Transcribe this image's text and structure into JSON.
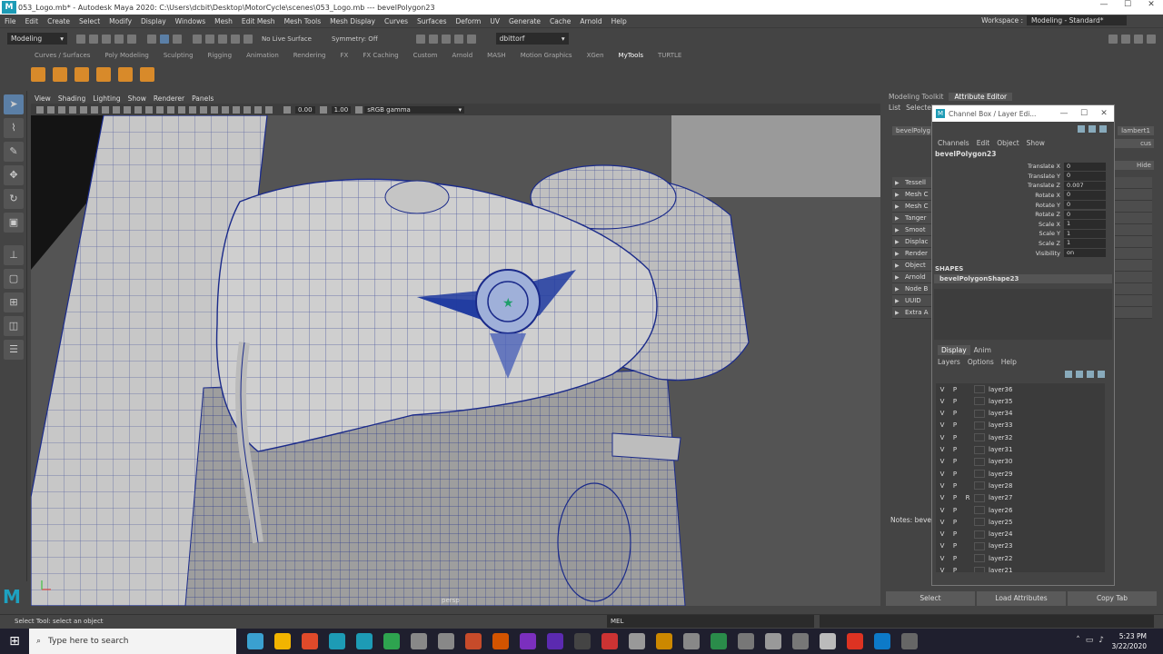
{
  "window": {
    "title": "053_Logo.mb* - Autodesk Maya 2020: C:\\Users\\dcbit\\Desktop\\MotorCycle\\scenes\\053_Logo.mb   ---   bevelPolygon23",
    "controls": [
      "—",
      "☐",
      "✕"
    ]
  },
  "menubar": {
    "items": [
      "File",
      "Edit",
      "Create",
      "Select",
      "Modify",
      "Display",
      "Windows",
      "Mesh",
      "Edit Mesh",
      "Mesh Tools",
      "Mesh Display",
      "Curves",
      "Surfaces",
      "Deform",
      "UV",
      "Generate",
      "Cache",
      "Arnold",
      "Help"
    ],
    "workspace_label": "Workspace :",
    "workspace_value": "Modeling - Standard*"
  },
  "statusline": {
    "mode": "Modeling",
    "live_surface": "No Live Surface",
    "symmetry": "Symmetry: Off",
    "user": "dbittorf"
  },
  "shelf": {
    "tabs": [
      "Curves / Surfaces",
      "Poly Modeling",
      "Sculpting",
      "Rigging",
      "Animation",
      "Rendering",
      "FX",
      "FX Caching",
      "Custom",
      "Arnold",
      "MASH",
      "Motion Graphics",
      "XGen",
      "MyTools",
      "TURTLE"
    ],
    "active_tab": "MyTools"
  },
  "viewport": {
    "menu": [
      "View",
      "Shading",
      "Lighting",
      "Show",
      "Renderer",
      "Panels"
    ],
    "exposure": "0.00",
    "gamma": "1.00",
    "color_space": "sRGB gamma",
    "camera_label": "persp"
  },
  "right_panel": {
    "tabs": [
      "Modeling Toolkit",
      "Attribute Editor"
    ],
    "active_tab": "Attribute Editor",
    "menu": [
      "List",
      "Selecte"
    ],
    "partial_fields": [
      "bevelPolyg",
      "lambert1",
      "cus",
      "Hide"
    ],
    "sections": [
      "Tessell",
      "Mesh C",
      "Mesh C",
      "Tanger",
      "Smoot",
      "Displac",
      "Render",
      "Object",
      "Arnold",
      "Node B",
      "UUID",
      "Extra A"
    ],
    "notes_label": "Notes: beve",
    "buttons": [
      "Select",
      "Load Attributes",
      "Copy Tab"
    ]
  },
  "channel_box": {
    "title": "Channel Box / Layer Edi...",
    "menu": [
      "Channels",
      "Edit",
      "Object",
      "Show"
    ],
    "object_name": "bevelPolygon23",
    "attributes": [
      {
        "name": "Translate X",
        "value": "0"
      },
      {
        "name": "Translate Y",
        "value": "0"
      },
      {
        "name": "Translate Z",
        "value": "0.007"
      },
      {
        "name": "Rotate X",
        "value": "0"
      },
      {
        "name": "Rotate Y",
        "value": "0"
      },
      {
        "name": "Rotate Z",
        "value": "0"
      },
      {
        "name": "Scale X",
        "value": "1"
      },
      {
        "name": "Scale Y",
        "value": "1"
      },
      {
        "name": "Scale Z",
        "value": "1"
      },
      {
        "name": "Visibility",
        "value": "on"
      }
    ],
    "shapes_header": "SHAPES",
    "shape_name": "bevelPolygonShape23"
  },
  "layer_editor": {
    "tabs": [
      "Display",
      "Anim"
    ],
    "active_tab": "Display",
    "menu": [
      "Layers",
      "Options",
      "Help"
    ],
    "layers": [
      {
        "v": "V",
        "p": "P",
        "r": "",
        "name": "layer36"
      },
      {
        "v": "V",
        "p": "P",
        "r": "",
        "name": "layer35"
      },
      {
        "v": "V",
        "p": "P",
        "r": "",
        "name": "layer34"
      },
      {
        "v": "V",
        "p": "P",
        "r": "",
        "name": "layer33"
      },
      {
        "v": "V",
        "p": "P",
        "r": "",
        "name": "layer32"
      },
      {
        "v": "V",
        "p": "P",
        "r": "",
        "name": "layer31"
      },
      {
        "v": "V",
        "p": "P",
        "r": "",
        "name": "layer30"
      },
      {
        "v": "V",
        "p": "P",
        "r": "",
        "name": "layer29"
      },
      {
        "v": "V",
        "p": "P",
        "r": "",
        "name": "layer28"
      },
      {
        "v": "V",
        "p": "P",
        "r": "R",
        "name": "layer27"
      },
      {
        "v": "V",
        "p": "P",
        "r": "",
        "name": "layer26"
      },
      {
        "v": "V",
        "p": "P",
        "r": "",
        "name": "layer25"
      },
      {
        "v": "V",
        "p": "P",
        "r": "",
        "name": "layer24"
      },
      {
        "v": "V",
        "p": "P",
        "r": "",
        "name": "layer23"
      },
      {
        "v": "V",
        "p": "P",
        "r": "",
        "name": "layer22"
      },
      {
        "v": "V",
        "p": "P",
        "r": "",
        "name": "layer21"
      }
    ]
  },
  "helpline": {
    "text": "Select Tool: select an object",
    "field": "MEL"
  },
  "taskbar": {
    "search_placeholder": "Type here to search",
    "time": "5:23 PM",
    "date": "3/22/2020",
    "app_colors": [
      "#3aa0d0",
      "#f2b400",
      "#e04a2a",
      "#1d9bb5",
      "#1d9bb5",
      "#2ea44f",
      "#888888",
      "#888888",
      "#c74b2a",
      "#d35400",
      "#7b2fbe",
      "#5b2ab0",
      "#444444",
      "#cc3333",
      "#999999",
      "#cc8800",
      "#888888",
      "#2a8c4a",
      "#777777",
      "#999999",
      "#777777",
      "#bbbbbb",
      "#dd3322",
      "#0d7ac8",
      "#666666"
    ]
  },
  "colors": {
    "accent": "#1d9bb5",
    "wire": "#1a2a8a",
    "surface": "#c9c9c9"
  }
}
